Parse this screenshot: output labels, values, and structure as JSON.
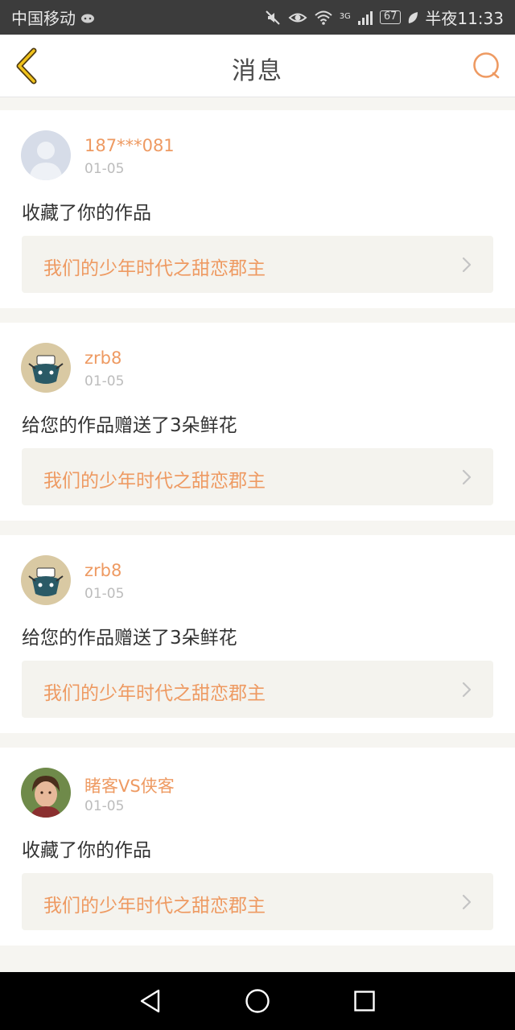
{
  "status_bar": {
    "carrier": "中国移动",
    "network": "3G",
    "battery": "67",
    "time": "半夜11:33"
  },
  "header": {
    "title": "消息",
    "back_icon": "chevron-left-icon",
    "search_icon": "search-icon"
  },
  "colors": {
    "accent": "#ee9a62",
    "background": "#f6f5f1",
    "link_bg": "#f4f3ee"
  },
  "messages": [
    {
      "username": "187***081",
      "date": "01-05",
      "action": "收藏了你的作品",
      "work_title": "我们的少年时代之甜恋郡主",
      "avatar": "default-avatar"
    },
    {
      "username": "zrb8",
      "date": "01-05",
      "action": "给您的作品赠送了3朵鲜花",
      "work_title": "我们的少年时代之甜恋郡主",
      "avatar": "cartoon-avatar"
    },
    {
      "username": "zrb8",
      "date": "01-05",
      "action": "给您的作品赠送了3朵鲜花",
      "work_title": "我们的少年时代之甜恋郡主",
      "avatar": "cartoon-avatar"
    },
    {
      "username": "睹客VS侠客",
      "date": "01-05",
      "action": "收藏了你的作品",
      "work_title": "我们的少年时代之甜恋郡主",
      "avatar": "photo-avatar"
    }
  ],
  "nav_bar": {
    "back": "triangle-back-icon",
    "home": "circle-home-icon",
    "recents": "square-recents-icon"
  }
}
